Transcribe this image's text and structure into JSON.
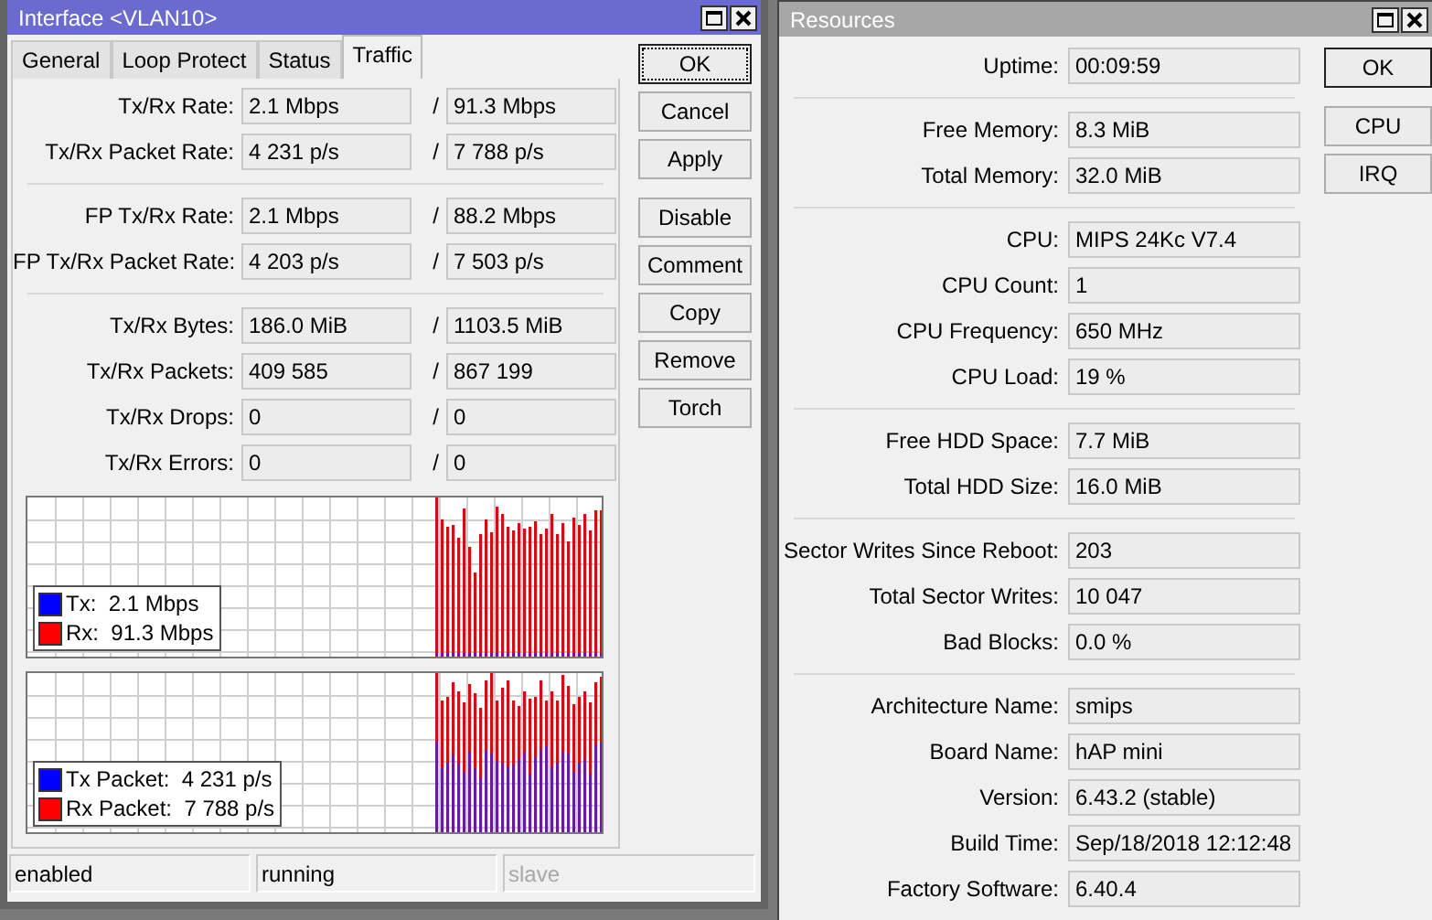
{
  "interface_window": {
    "title": "Interface <VLAN10>",
    "active": true,
    "tabs": [
      {
        "label": "General",
        "selected": false
      },
      {
        "label": "Loop Protect",
        "selected": false
      },
      {
        "label": "Status",
        "selected": false
      },
      {
        "label": "Traffic",
        "selected": true
      }
    ],
    "field_groups": [
      [
        {
          "label": "Tx/Rx Rate:",
          "tx": "2.1 Mbps",
          "separator": "/",
          "rx": "91.3 Mbps"
        },
        {
          "label": "Tx/Rx Packet Rate:",
          "tx": "4 231 p/s",
          "separator": "/",
          "rx": "7 788 p/s"
        }
      ],
      [
        {
          "label": "FP Tx/Rx Rate:",
          "tx": "2.1 Mbps",
          "separator": "/",
          "rx": "88.2 Mbps"
        },
        {
          "label": "FP Tx/Rx Packet Rate:",
          "tx": "4 203 p/s",
          "separator": "/",
          "rx": "7 503 p/s"
        }
      ],
      [
        {
          "label": "Tx/Rx Bytes:",
          "tx": "186.0 MiB",
          "separator": "/",
          "rx": "1103.5 MiB"
        },
        {
          "label": "Tx/Rx Packets:",
          "tx": "409 585",
          "separator": "/",
          "rx": "867 199"
        },
        {
          "label": "Tx/Rx Drops:",
          "tx": "0",
          "separator": "/",
          "rx": "0"
        },
        {
          "label": "Tx/Rx Errors:",
          "tx": "0",
          "separator": "/",
          "rx": "0"
        }
      ]
    ],
    "graphs": [
      {
        "kind": "rate",
        "legend": [
          {
            "label": "Tx:  2.1 Mbps",
            "color": "#0000ff"
          },
          {
            "label": "Rx:  91.3 Mbps",
            "color": "#ff0000"
          }
        ]
      },
      {
        "kind": "packets",
        "legend": [
          {
            "label": "Tx Packet:  4 231 p/s",
            "color": "#0000ff"
          },
          {
            "label": "Rx Packet:  7 788 p/s",
            "color": "#ff0000"
          }
        ]
      }
    ],
    "button_groups": [
      [
        {
          "label": "OK",
          "default": true,
          "focused": true
        },
        {
          "label": "Cancel",
          "default": false,
          "focused": false
        },
        {
          "label": "Apply",
          "default": false,
          "focused": false
        }
      ],
      [
        {
          "label": "Disable",
          "default": false,
          "focused": false
        },
        {
          "label": "Comment",
          "default": false,
          "focused": false
        },
        {
          "label": "Copy",
          "default": false,
          "focused": false
        },
        {
          "label": "Remove",
          "default": false,
          "focused": false
        },
        {
          "label": "Torch",
          "default": false,
          "focused": false
        }
      ]
    ],
    "status_bar": [
      {
        "text": "enabled",
        "disabled": false
      },
      {
        "text": "running",
        "disabled": false
      },
      {
        "text": "slave",
        "disabled": true
      }
    ]
  },
  "resources_window": {
    "title": "Resources",
    "active": false,
    "field_groups": [
      [
        {
          "label": "Uptime:",
          "value": "00:09:59"
        }
      ],
      [
        {
          "label": "Free Memory:",
          "value": "8.3 MiB"
        },
        {
          "label": "Total Memory:",
          "value": "32.0 MiB"
        }
      ],
      [
        {
          "label": "CPU:",
          "value": "MIPS 24Kc V7.4"
        },
        {
          "label": "CPU Count:",
          "value": "1"
        },
        {
          "label": "CPU Frequency:",
          "value": "650 MHz"
        },
        {
          "label": "CPU Load:",
          "value": "19 %"
        }
      ],
      [
        {
          "label": "Free HDD Space:",
          "value": "7.7 MiB"
        },
        {
          "label": "Total HDD Size:",
          "value": "16.0 MiB"
        }
      ],
      [
        {
          "label": "Sector Writes Since Reboot:",
          "value": "203"
        },
        {
          "label": "Total Sector Writes:",
          "value": "10 047"
        },
        {
          "label": "Bad Blocks:",
          "value": "0.0 %"
        }
      ],
      [
        {
          "label": "Architecture Name:",
          "value": "smips"
        },
        {
          "label": "Board Name:",
          "value": "hAP mini"
        },
        {
          "label": "Version:",
          "value": "6.43.2 (stable)"
        },
        {
          "label": "Build Time:",
          "value": "Sep/18/2018 12:12:48"
        },
        {
          "label": "Factory Software:",
          "value": "6.40.4"
        }
      ]
    ],
    "button_groups": [
      [
        {
          "label": "OK",
          "default": true,
          "focused": false
        }
      ],
      [
        {
          "label": "CPU",
          "default": false,
          "focused": false
        },
        {
          "label": "IRQ",
          "default": false,
          "focused": false
        }
      ]
    ]
  }
}
